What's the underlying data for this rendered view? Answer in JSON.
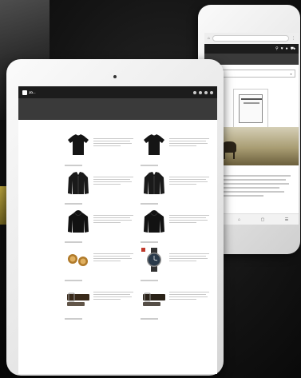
{
  "colors": {
    "background": "#111111",
    "device_frame": "#eeeeee",
    "store_nav": "#1c1c1c",
    "store_hero": "#3a3a3a",
    "price_blue": "#1f3f8a"
  },
  "tablet": {
    "logo": "JD...",
    "nav_items": [
      "",
      "",
      "",
      ""
    ],
    "breadcrumb": "",
    "title": "",
    "sort_label": "",
    "sidebar": {
      "heading": "",
      "items": [
        "",
        "",
        "",
        "",
        "",
        "",
        ""
      ]
    },
    "products": [
      {
        "name": "",
        "price": "",
        "icon": "tshirt-icon",
        "color": "#151515"
      },
      {
        "name": "",
        "price": "",
        "icon": "tshirt-icon",
        "color": "#151515"
      },
      {
        "name": "",
        "price": "",
        "icon": "jacket-icon",
        "color": "#1a1a1a"
      },
      {
        "name": "",
        "price": "",
        "icon": "jacket-icon",
        "color": "#1a1a1a"
      },
      {
        "name": "",
        "price": "",
        "icon": "hoodie-icon",
        "color": "#121212"
      },
      {
        "name": "",
        "price": "",
        "icon": "hoodie-icon",
        "color": "#121212"
      },
      {
        "name": "",
        "price": "",
        "icon": "cufflinks-icon",
        "color": "#b07a2a"
      },
      {
        "name": "",
        "price": "",
        "icon": "watch-icon",
        "color": "#2a3a4a"
      },
      {
        "name": "",
        "price": "",
        "icon": "belt-icon",
        "color": "#3a2a1a"
      },
      {
        "name": "",
        "price": "",
        "icon": "belt-icon",
        "color": "#2a2218"
      }
    ]
  },
  "phone": {
    "url": "",
    "logo": "",
    "breadcrumb": "",
    "hero_title": "",
    "select_value": "",
    "product_title": "",
    "icons": [
      "search-icon",
      "heart-icon",
      "user-icon",
      "cart-icon"
    ]
  }
}
